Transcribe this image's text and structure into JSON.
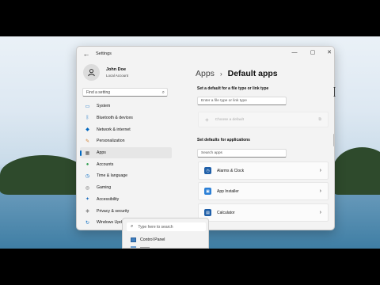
{
  "window": {
    "title": "Settings",
    "back_glyph": "←",
    "controls": {
      "minimize": "—",
      "maximize": "▢",
      "close": "✕"
    }
  },
  "profile": {
    "name": "John Doe",
    "account": "Local Account"
  },
  "search": {
    "placeholder": "Find a setting"
  },
  "sidebar": {
    "items": [
      {
        "label": "System",
        "icon": "monitor-icon",
        "color": "#0067c0"
      },
      {
        "label": "Bluetooth & devices",
        "icon": "bluetooth-icon",
        "color": "#0067c0"
      },
      {
        "label": "Network & internet",
        "icon": "wifi-icon",
        "color": "#0067c0"
      },
      {
        "label": "Personalization",
        "icon": "brush-icon",
        "color": "#d07a2a"
      },
      {
        "label": "Apps",
        "icon": "apps-icon",
        "color": "#555555",
        "active": true
      },
      {
        "label": "Accounts",
        "icon": "person-icon",
        "color": "#2f9e4f"
      },
      {
        "label": "Time & language",
        "icon": "globe-clock-icon",
        "color": "#0067c0"
      },
      {
        "label": "Gaming",
        "icon": "gamepad-icon",
        "color": "#666666"
      },
      {
        "label": "Accessibility",
        "icon": "accessibility-icon",
        "color": "#1f6fbf"
      },
      {
        "label": "Privacy & security",
        "icon": "shield-icon",
        "color": "#777777"
      },
      {
        "label": "Windows Upda",
        "icon": "update-icon",
        "color": "#0067c0"
      }
    ]
  },
  "breadcrumb": {
    "parent": "Apps",
    "separator": "›",
    "current": "Default apps"
  },
  "file_type_section": {
    "label": "Set a default for a file type or link type",
    "placeholder": "Enter a file type or link type",
    "choose_label": "Choose a default"
  },
  "apps_section": {
    "label": "Set defaults for applications",
    "placeholder": "Search apps",
    "apps": [
      {
        "name": "Alarms & Clock",
        "icon": "alarm-clock-icon",
        "color": "#1f5fa8"
      },
      {
        "name": "App Installer",
        "icon": "package-icon",
        "color": "#2b7fd6"
      },
      {
        "name": "Calculator",
        "icon": "calculator-icon",
        "color": "#1f5fa8"
      }
    ]
  },
  "taskbar_search": {
    "placeholder": "Type here to search",
    "result": "Control Panel"
  }
}
